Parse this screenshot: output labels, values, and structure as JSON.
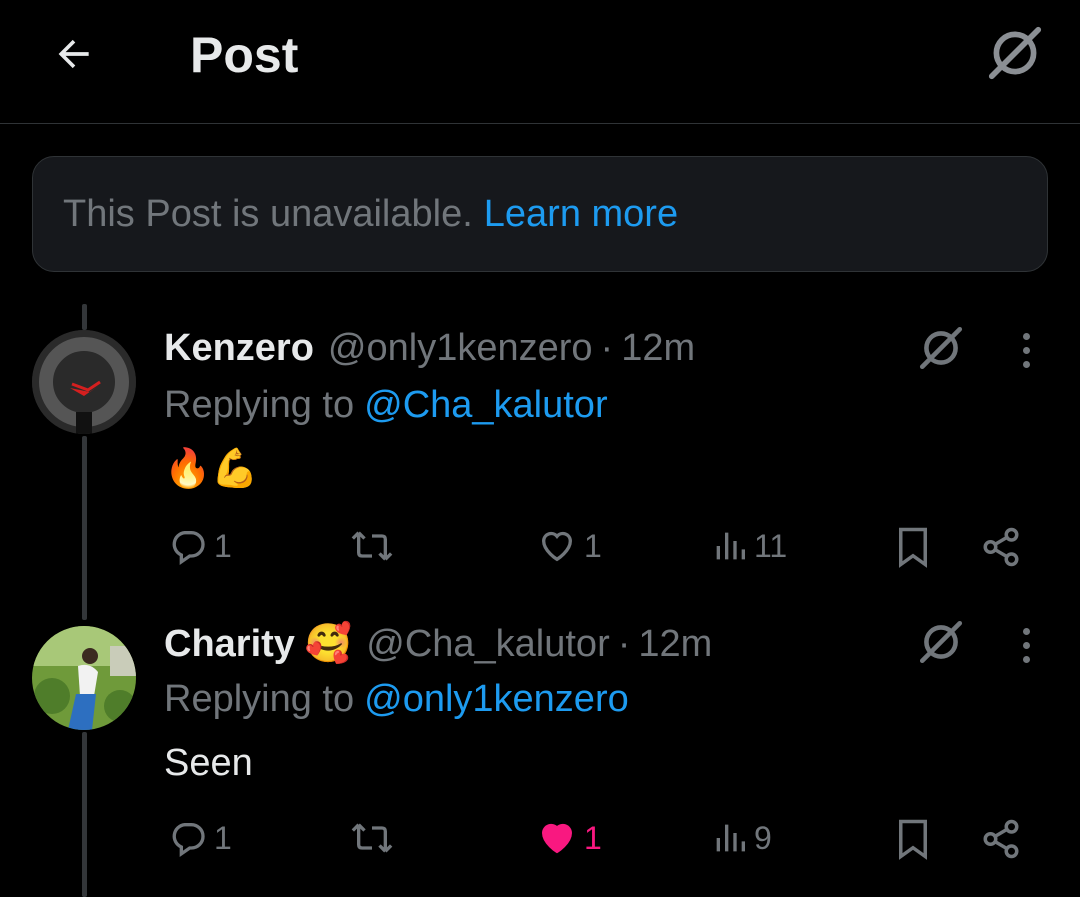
{
  "header": {
    "title": "Post"
  },
  "notice": {
    "text": "This Post is unavailable.",
    "link": "Learn more"
  },
  "tweets": [
    {
      "name": "Kenzero",
      "name_emoji": "",
      "handle": "@only1kenzero",
      "dot": "·",
      "time": "12m",
      "reply_prefix": "Replying to",
      "reply_handle": "@Cha_kalutor",
      "body": "🔥💪",
      "replies": "1",
      "reposts": "",
      "likes": "1",
      "liked": false,
      "views": "11"
    },
    {
      "name": "Charity",
      "name_emoji": "🥰",
      "handle": "@Cha_kalutor",
      "dot": "·",
      "time": "12m",
      "reply_prefix": "Replying to",
      "reply_handle": "@only1kenzero",
      "body": "Seen",
      "replies": "1",
      "reposts": "",
      "likes": "1",
      "liked": true,
      "views": "9"
    }
  ],
  "colors": {
    "accent": "#1d9bf0",
    "like": "#f91880",
    "muted": "#71767b",
    "background": "#000000"
  },
  "icons": [
    "back-arrow-icon",
    "grok-icon",
    "more-icon",
    "reply-icon",
    "repost-icon",
    "heart-icon",
    "views-icon",
    "bookmark-icon",
    "share-icon"
  ]
}
